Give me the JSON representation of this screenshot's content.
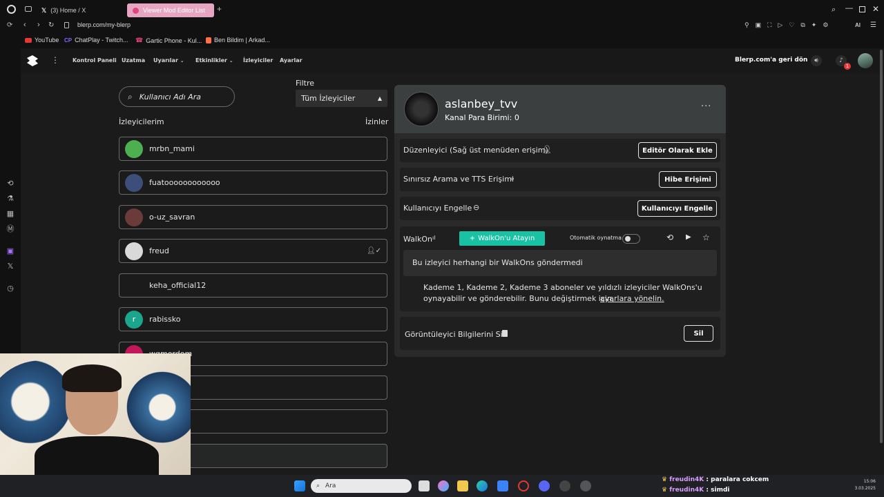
{
  "browser": {
    "tabs": [
      {
        "label": "(3) Home / X"
      },
      {
        "label": "Viewer Mod Editor List"
      }
    ],
    "url": "blerp.com/my-blerp",
    "bookmarks": [
      {
        "label": "YouTube"
      },
      {
        "label": "ChatPlay - Twitch..."
      },
      {
        "label": "Gartic Phone - Kul..."
      },
      {
        "label": "Ben Bildim | Arkad..."
      }
    ],
    "ai_label": "AI"
  },
  "header": {
    "nav": [
      {
        "label": "Kontrol Paneli"
      },
      {
        "label": "Uzatma"
      },
      {
        "label": "Uyarılar"
      },
      {
        "label": "Etkinlikler"
      },
      {
        "label": "İzleyiciler"
      },
      {
        "label": "Ayarlar"
      }
    ],
    "back_link": "Blerp.com'a geri dön",
    "notif_count": "1"
  },
  "left": {
    "search_placeholder": "Kullanıcı Adı Ara",
    "filter_label": "Filtre",
    "filter_value": "Tüm İzleyiciler",
    "viewers_heading": "İzleyicilerim",
    "permissions_heading": "İzinler",
    "viewers": [
      {
        "name": "mrbn_mami",
        "avatar_color": "#4caf50"
      },
      {
        "name": "fuatoooooooooooo",
        "avatar_color": "#3b4f7a"
      },
      {
        "name": "o-uz_savran",
        "avatar_color": "#6b3b3b"
      },
      {
        "name": "freud",
        "avatar_color": "#d9d9d9",
        "editor": true
      },
      {
        "name": "keha_official12",
        "avatar_color": ""
      },
      {
        "name": "rabissko",
        "avatar_color": "#1aa58c",
        "initial": "r"
      },
      {
        "name": "wgmordom",
        "avatar_color": "#c2185b"
      }
    ]
  },
  "detail": {
    "username": "aslanbey_tvv",
    "currency": "Kanal Para Birimi: 0",
    "rows": [
      {
        "label": "Düzenleyici (Sağ üst menüden erişim)",
        "button": "Editör Olarak Ekle"
      },
      {
        "label": "Sınırsız Arama ve TTS Erişimi",
        "button": "Hibe Erişimi"
      },
      {
        "label": "Kullanıcıyı Engelle",
        "button": "Kullanıcıyı Engelle"
      }
    ],
    "walkon": {
      "label": "WalkOn",
      "assign_button": "WalkOn'u Atayın",
      "autoplay_label": "Otomatik oynatma",
      "empty_text": "Bu izleyici herhangi bir WalkOns göndermedi",
      "info_line1": "Kademe 1, Kademe 2, Kademe 3 aboneler ve yıldızlı izleyiciler WalkOns'u",
      "info_line2": "oynayabilir ve gönderebilir. Bunu değiştirmek için,",
      "info_link": "ayarlara yönelin."
    },
    "delete": {
      "label": "Görüntüleyici Bilgilerini Sil",
      "button": "Sil"
    }
  },
  "taskbar": {
    "search_placeholder": "Ara",
    "chat": [
      {
        "user": "freudin4K",
        "msg": "paralara cokcem"
      },
      {
        "user": "freudin4K",
        "msg": "simdi"
      }
    ],
    "time": "15:06",
    "date": "3.03.2025"
  },
  "colors": {
    "accent": "#19c2a4",
    "panel": "#2a2a2a",
    "header": "#3b3f3f"
  }
}
